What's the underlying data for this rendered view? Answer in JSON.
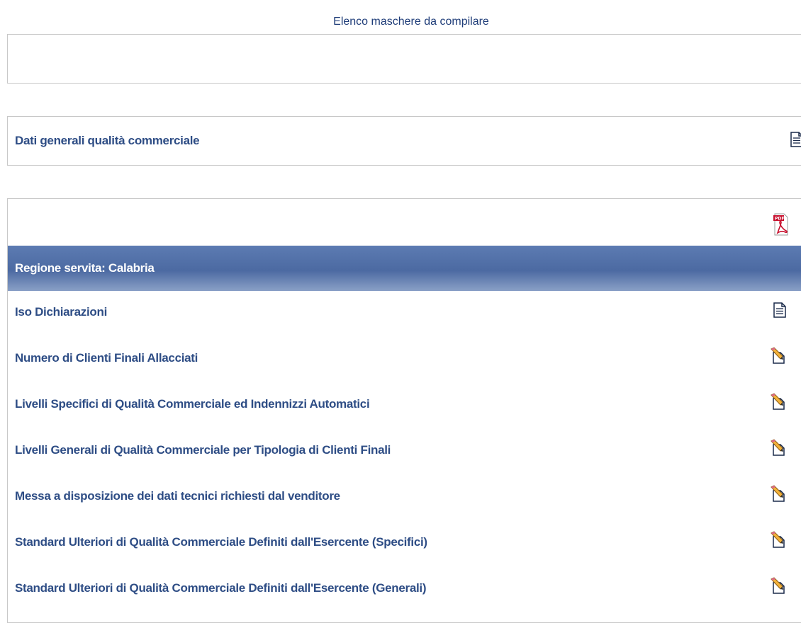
{
  "page": {
    "title": "Elenco maschere da compilare"
  },
  "general_section": {
    "label": "Dati generali qualità commerciale",
    "icon": "document-icon"
  },
  "region_section": {
    "pdf_icon": "pdf-icon",
    "header": "Regione servita: Calabria",
    "items": [
      {
        "label": "Iso Dichiarazioni",
        "icon": "document-icon"
      },
      {
        "label": "Numero di Clienti Finali Allacciati",
        "icon": "edit-icon"
      },
      {
        "label": "Livelli Specifici di Qualità Commerciale ed Indennizzi Automatici",
        "icon": "edit-icon"
      },
      {
        "label": "Livelli Generali di Qualità Commerciale per Tipologia di Clienti Finali",
        "icon": "edit-icon"
      },
      {
        "label": "Messa a disposizione dei dati tecnici richiesti dal venditore",
        "icon": "edit-icon"
      },
      {
        "label": "Standard Ulteriori di Qualità Commerciale Definiti dall'Esercente (Specifici)",
        "icon": "edit-icon"
      },
      {
        "label": "Standard Ulteriori di Qualità Commerciale Definiti dall'Esercente (Generali)",
        "icon": "edit-icon"
      }
    ]
  },
  "colors": {
    "link": "#2e4d85",
    "title": "#1e3c78",
    "header_bg": "#5c7bb2"
  }
}
